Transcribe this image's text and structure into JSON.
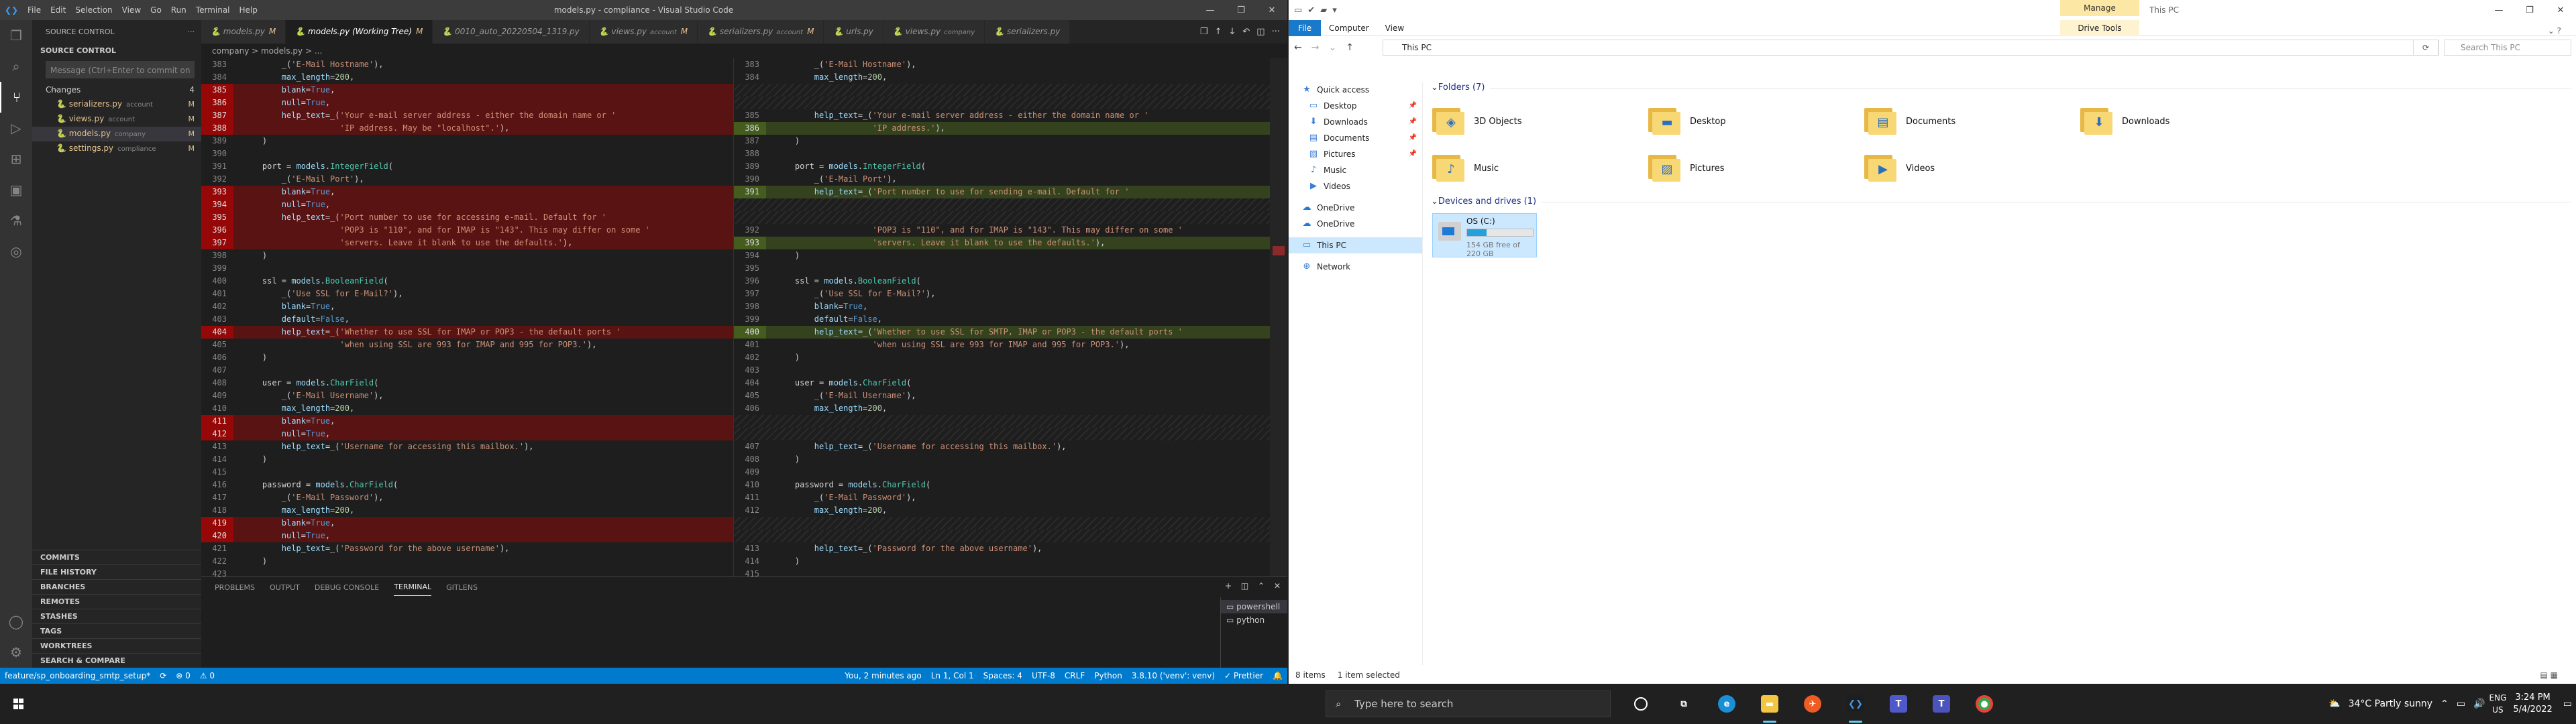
{
  "vscode": {
    "title": "models.py - compliance - Visual Studio Code",
    "menu": [
      "File",
      "Edit",
      "Selection",
      "View",
      "Go",
      "Run",
      "Terminal",
      "Help"
    ],
    "sidebar": {
      "header": "SOURCE CONTROL",
      "section": "SOURCE CONTROL",
      "message_placeholder": "Message (Ctrl+Enter to commit on ...",
      "changes_label": "Changes",
      "changes_count": "4",
      "files": [
        {
          "name": "serializers.py",
          "path": "account",
          "status": "M"
        },
        {
          "name": "views.py",
          "path": "account",
          "status": "M"
        },
        {
          "name": "models.py",
          "path": "company",
          "status": "M"
        },
        {
          "name": "settings.py",
          "path": "compliance",
          "status": "M"
        }
      ],
      "lower_sections": [
        "COMMITS",
        "FILE HISTORY",
        "BRANCHES",
        "REMOTES",
        "STASHES",
        "TAGS",
        "WORKTREES",
        "SEARCH & COMPARE"
      ]
    },
    "tabs": [
      {
        "label": "models.py",
        "suffix": "M"
      },
      {
        "label": "models.py (Working Tree)",
        "suffix": "M"
      },
      {
        "label": "0010_auto_20220504_1319.py",
        "suffix": ""
      },
      {
        "label": "views.py",
        "detail": "account",
        "suffix": "M"
      },
      {
        "label": "serializers.py",
        "detail": "account",
        "suffix": "M"
      },
      {
        "label": "urls.py",
        "suffix": ""
      },
      {
        "label": "views.py",
        "detail": "company",
        "suffix": ""
      },
      {
        "label": "serializers.py",
        "suffix": ""
      }
    ],
    "breadcrumb": "company  >  models.py  >  ...",
    "left_lines": [
      {
        "no": "383",
        "t": "        _('E-Mail Hostname'),",
        "k": ""
      },
      {
        "no": "384",
        "t": "        max_length=200,",
        "k": ""
      },
      {
        "no": "385",
        "t": "        blank=True,",
        "k": "del"
      },
      {
        "no": "386",
        "t": "        null=True,",
        "k": "del"
      },
      {
        "no": "387",
        "t": "        help_text=_('Your e-mail server address - either the domain name or '",
        "k": "del"
      },
      {
        "no": "388",
        "t": "                    'IP address. May be \"localhost\".'),",
        "k": "del"
      },
      {
        "no": "389",
        "t": "    )",
        "k": ""
      },
      {
        "no": "390",
        "t": "",
        "k": ""
      },
      {
        "no": "391",
        "t": "    port = models.IntegerField(",
        "k": ""
      },
      {
        "no": "392",
        "t": "        _('E-Mail Port'),",
        "k": ""
      },
      {
        "no": "393",
        "t": "        blank=True,",
        "k": "del"
      },
      {
        "no": "394",
        "t": "        null=True,",
        "k": "del"
      },
      {
        "no": "395",
        "t": "        help_text=_('Port number to use for accessing e-mail. Default for '",
        "k": "del"
      },
      {
        "no": "396",
        "t": "                    'POP3 is \"110\", and for IMAP is \"143\". This may differ on some '",
        "k": "del"
      },
      {
        "no": "397",
        "t": "                    'servers. Leave it blank to use the defaults.'),",
        "k": "del"
      },
      {
        "no": "398",
        "t": "    )",
        "k": ""
      },
      {
        "no": "399",
        "t": "",
        "k": ""
      },
      {
        "no": "400",
        "t": "    ssl = models.BooleanField(",
        "k": ""
      },
      {
        "no": "401",
        "t": "        _('Use SSL for E-Mail?'),",
        "k": ""
      },
      {
        "no": "402",
        "t": "        blank=True,",
        "k": ""
      },
      {
        "no": "403",
        "t": "        default=False,",
        "k": ""
      },
      {
        "no": "404",
        "t": "        help_text=_('Whether to use SSL for IMAP or POP3 - the default ports '",
        "k": "del"
      },
      {
        "no": "405",
        "t": "                    'when using SSL are 993 for IMAP and 995 for POP3.'),",
        "k": ""
      },
      {
        "no": "406",
        "t": "    )",
        "k": ""
      },
      {
        "no": "407",
        "t": "",
        "k": ""
      },
      {
        "no": "408",
        "t": "    user = models.CharField(",
        "k": ""
      },
      {
        "no": "409",
        "t": "        _('E-Mail Username'),",
        "k": ""
      },
      {
        "no": "410",
        "t": "        max_length=200,",
        "k": ""
      },
      {
        "no": "411",
        "t": "        blank=True,",
        "k": "del"
      },
      {
        "no": "412",
        "t": "        null=True,",
        "k": "del"
      },
      {
        "no": "413",
        "t": "        help_text=_('Username for accessing this mailbox.'),",
        "k": ""
      },
      {
        "no": "414",
        "t": "    )",
        "k": ""
      },
      {
        "no": "415",
        "t": "",
        "k": ""
      },
      {
        "no": "416",
        "t": "    password = models.CharField(",
        "k": ""
      },
      {
        "no": "417",
        "t": "        _('E-Mail Password'),",
        "k": ""
      },
      {
        "no": "418",
        "t": "        max_length=200,",
        "k": ""
      },
      {
        "no": "419",
        "t": "        blank=True,",
        "k": "del"
      },
      {
        "no": "420",
        "t": "        null=True,",
        "k": "del"
      },
      {
        "no": "421",
        "t": "        help_text=_('Password for the above username'),",
        "k": ""
      },
      {
        "no": "422",
        "t": "    )",
        "k": ""
      },
      {
        "no": "423",
        "t": "",
        "k": ""
      }
    ],
    "right_lines": [
      {
        "no": "383",
        "t": "        _('E-Mail Hostname'),",
        "k": ""
      },
      {
        "no": "384",
        "t": "        max_length=200,",
        "k": ""
      },
      {
        "no": "",
        "t": "",
        "k": "gap"
      },
      {
        "no": "",
        "t": "",
        "k": "gap"
      },
      {
        "no": "385",
        "t": "        help_text=_('Your e-mail server address - either the domain name or '",
        "k": ""
      },
      {
        "no": "386",
        "t": "                    'IP address.'),",
        "k": "ins"
      },
      {
        "no": "387",
        "t": "    )",
        "k": ""
      },
      {
        "no": "388",
        "t": "",
        "k": ""
      },
      {
        "no": "389",
        "t": "    port = models.IntegerField(",
        "k": ""
      },
      {
        "no": "390",
        "t": "        _('E-Mail Port'),",
        "k": ""
      },
      {
        "no": "391",
        "t": "        help_text=_('Port number to use for sending e-mail. Default for '",
        "k": "ins"
      },
      {
        "no": "",
        "t": "",
        "k": "gap"
      },
      {
        "no": "",
        "t": "",
        "k": "gap"
      },
      {
        "no": "392",
        "t": "                    'POP3 is \"110\", and for IMAP is \"143\". This may differ on some '",
        "k": ""
      },
      {
        "no": "393",
        "t": "                    'servers. Leave it blank to use the defaults.'),",
        "k": "ins"
      },
      {
        "no": "394",
        "t": "    )",
        "k": ""
      },
      {
        "no": "395",
        "t": "",
        "k": ""
      },
      {
        "no": "396",
        "t": "    ssl = models.BooleanField(",
        "k": ""
      },
      {
        "no": "397",
        "t": "        _('Use SSL for E-Mail?'),",
        "k": ""
      },
      {
        "no": "398",
        "t": "        blank=True,",
        "k": ""
      },
      {
        "no": "399",
        "t": "        default=False,",
        "k": ""
      },
      {
        "no": "400",
        "t": "        help_text=_('Whether to use SSL for SMTP, IMAP or POP3 - the default ports '",
        "k": "ins"
      },
      {
        "no": "401",
        "t": "                    'when using SSL are 993 for IMAP and 995 for POP3.'),",
        "k": ""
      },
      {
        "no": "402",
        "t": "    )",
        "k": ""
      },
      {
        "no": "403",
        "t": "",
        "k": ""
      },
      {
        "no": "404",
        "t": "    user = models.CharField(",
        "k": ""
      },
      {
        "no": "405",
        "t": "        _('E-Mail Username'),",
        "k": ""
      },
      {
        "no": "406",
        "t": "        max_length=200,",
        "k": ""
      },
      {
        "no": "",
        "t": "",
        "k": "gap"
      },
      {
        "no": "",
        "t": "",
        "k": "gap"
      },
      {
        "no": "407",
        "t": "        help_text=_('Username for accessing this mailbox.'),",
        "k": ""
      },
      {
        "no": "408",
        "t": "    )",
        "k": ""
      },
      {
        "no": "409",
        "t": "",
        "k": ""
      },
      {
        "no": "410",
        "t": "    password = models.CharField(",
        "k": ""
      },
      {
        "no": "411",
        "t": "        _('E-Mail Password'),",
        "k": ""
      },
      {
        "no": "412",
        "t": "        max_length=200,",
        "k": ""
      },
      {
        "no": "",
        "t": "",
        "k": "gap"
      },
      {
        "no": "",
        "t": "",
        "k": "gap"
      },
      {
        "no": "413",
        "t": "        help_text=_('Password for the above username'),",
        "k": ""
      },
      {
        "no": "414",
        "t": "    )",
        "k": ""
      },
      {
        "no": "415",
        "t": "",
        "k": ""
      }
    ],
    "panel": {
      "tabs": [
        "PROBLEMS",
        "OUTPUT",
        "DEBUG CONSOLE",
        "TERMINAL",
        "GITLENS"
      ],
      "active": "TERMINAL",
      "terminals": [
        "powershell",
        "python"
      ]
    },
    "status": {
      "branch": "feature/sp_onboarding_smtp_setup*",
      "sync": "⟳",
      "errors": "⊗ 0",
      "warnings": "⚠ 0",
      "blame": "You, 2 minutes ago",
      "position": "Ln 1, Col 1",
      "spaces": "Spaces: 4",
      "encoding": "UTF-8",
      "eol": "CRLF",
      "language": "Python",
      "interpreter": "3.8.10 ('venv': venv)",
      "prettier": "✓ Prettier"
    }
  },
  "explorer": {
    "title": "This PC",
    "manage_label": "Manage",
    "ribbon": [
      "File",
      "Computer",
      "View"
    ],
    "drive_tools": "Drive Tools",
    "address": "This PC",
    "search_placeholder": "Search This PC",
    "nav": [
      {
        "label": "Quick access",
        "icon": "★",
        "pinned": false
      },
      {
        "label": "Desktop",
        "icon": "▭",
        "pinned": true
      },
      {
        "label": "Downloads",
        "icon": "⬇",
        "pinned": true
      },
      {
        "label": "Documents",
        "icon": "▤",
        "pinned": true
      },
      {
        "label": "Pictures",
        "icon": "▨",
        "pinned": true
      },
      {
        "label": "Music",
        "icon": "♪",
        "pinned": false
      },
      {
        "label": "Videos",
        "icon": "▶",
        "pinned": false
      },
      {
        "label": "OneDrive",
        "icon": "☁",
        "pinned": false
      },
      {
        "label": "OneDrive",
        "icon": "☁",
        "pinned": false
      },
      {
        "label": "This PC",
        "icon": "▭",
        "pinned": false
      },
      {
        "label": "Network",
        "icon": "⊕",
        "pinned": false
      }
    ],
    "folders_header": "Folders (7)",
    "folders": [
      {
        "name": "3D Objects",
        "glyph": "◈"
      },
      {
        "name": "Desktop",
        "glyph": "▬"
      },
      {
        "name": "Documents",
        "glyph": "▤"
      },
      {
        "name": "Downloads",
        "glyph": "⬇"
      },
      {
        "name": "Music",
        "glyph": "♪"
      },
      {
        "name": "Pictures",
        "glyph": "▨"
      },
      {
        "name": "Videos",
        "glyph": "▶"
      }
    ],
    "drives_header": "Devices and drives (1)",
    "drive": {
      "name": "OS (C:)",
      "free": "154 GB free of 220 GB",
      "used_fraction": 0.3
    },
    "status_items": "8 items",
    "status_selected": "1 item selected"
  },
  "taskbar": {
    "search_placeholder": "Type here to search",
    "weather": "34°C  Partly sunny",
    "lang1": "ENG",
    "lang2": "US",
    "time": "3:24 PM",
    "date": "5/4/2022"
  },
  "colors": {
    "vscode_accent": "#007acc",
    "explorer_accent": "#1979ca",
    "del": "#c80000",
    "ins": "#506e1e"
  }
}
